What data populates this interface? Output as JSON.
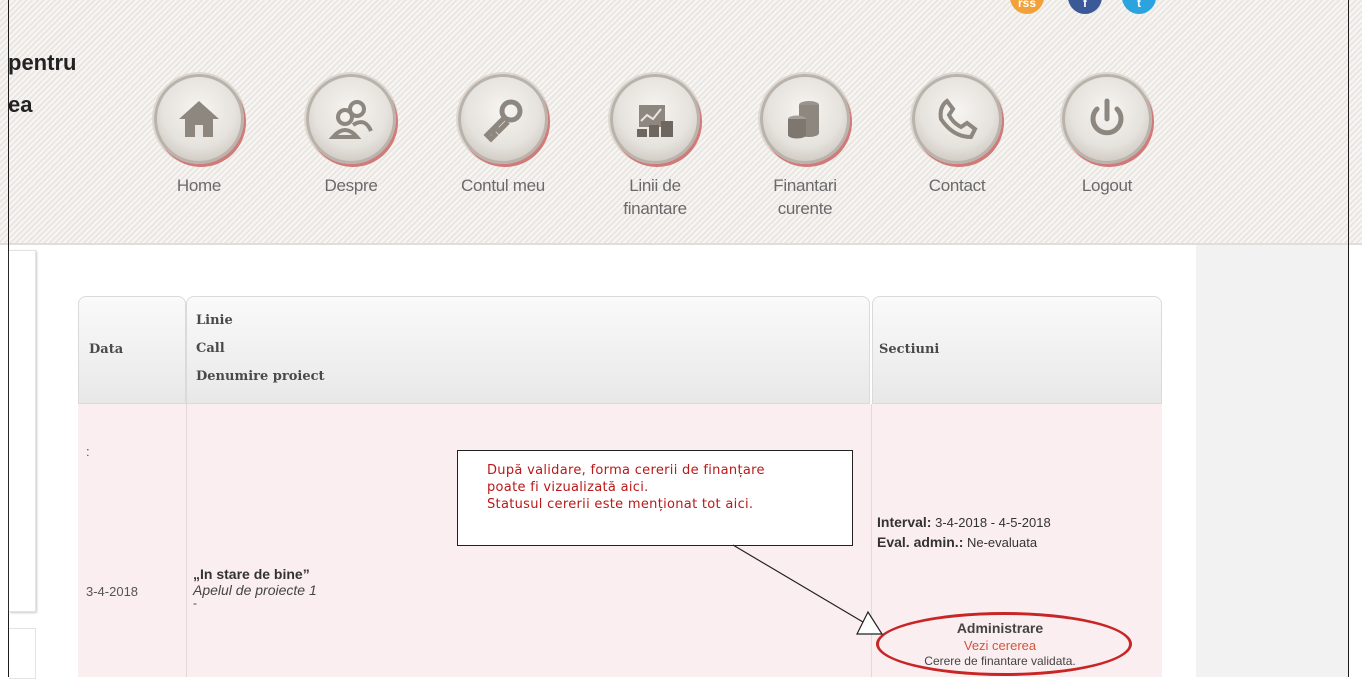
{
  "brand": {
    "line1": "pentru",
    "line2": "ea"
  },
  "social": [
    {
      "icon": "rss-icon",
      "label": "rss"
    },
    {
      "icon": "facebook-icon",
      "label": "f"
    },
    {
      "icon": "twitter-icon",
      "label": "t"
    }
  ],
  "nav": [
    {
      "label": "Home",
      "icon": "home-icon"
    },
    {
      "label": "Despre",
      "icon": "users-icon"
    },
    {
      "label": "Contul meu",
      "icon": "key-icon"
    },
    {
      "label": "Linii de\nfinantare",
      "icon": "chart-icon"
    },
    {
      "label": "Finantari\ncurente",
      "icon": "coins-icon"
    },
    {
      "label": "Contact",
      "icon": "phone-icon"
    },
    {
      "label": "Logout",
      "icon": "power-icon"
    }
  ],
  "table": {
    "headers": {
      "date": "Data",
      "line": "Linie",
      "call": "Call",
      "project": "Denumire proiect",
      "sections": "Sectiuni"
    },
    "row": {
      "mark": ":",
      "date": "3-4-2018",
      "project_name": "„In stare de bine”",
      "call_name": "Apelul de proiecte 1",
      "dash": "-",
      "interval_label": "Interval:",
      "interval_value": "3-4-2018 - 4-5-2018",
      "eval_label": "Eval. admin.:",
      "eval_value": "Ne-evaluata",
      "admin_title": "Administrare",
      "admin_link": "Vezi cererea",
      "admin_status": "Cerere de finantare validata."
    }
  },
  "callout": {
    "line1": "După validare, forma cererii de finanțare",
    "line2": "poate fi vizualizată aici.",
    "line3": "Statusul cererii este menționat tot aici."
  },
  "colors": {
    "accent_red": "#c82626",
    "link_orange": "#d2553d",
    "row_pink": "#fbeef0"
  }
}
